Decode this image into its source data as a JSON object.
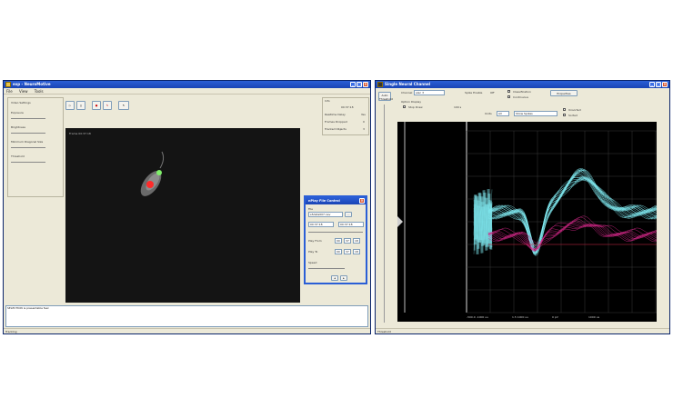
{
  "left_window": {
    "title": "exp - NeuroMotive",
    "menu": [
      "File",
      "View",
      "Tools"
    ],
    "video_settings_label": "Video Settings",
    "settings": [
      "Exposure",
      "Brightness",
      "Minimum Diagonal Size",
      "Threshold"
    ],
    "stats_header": "Info",
    "stats": [
      {
        "label": "",
        "value": "00:37:18"
      },
      {
        "label": "Realtime Delay",
        "value": "Yes"
      },
      {
        "label": "Frames Dropped",
        "value": "0"
      },
      {
        "label": "Tracked Objects",
        "value": "3"
      }
    ],
    "video_overlay_text": "Frame 00:37:18",
    "log_text": "SELECTION is presentable feel",
    "status_text": "Tracking"
  },
  "playback_dialog": {
    "title": "nPlay File Control",
    "file_label": "File",
    "file_value": "s5data007.nev",
    "time_start": "00:37:18",
    "time_end": "00:37:18",
    "play_from_label": "Play From",
    "play_to_label": "Play To",
    "speed_label": "Speed",
    "from_fields": [
      "00",
      "37",
      "18"
    ],
    "to_fields": [
      "00",
      "37",
      "18"
    ]
  },
  "right_window": {
    "title": "Single Neural Channel",
    "side_top_label": "Auto Threshold",
    "channel_label": "Channel",
    "channel_value": "elec 3",
    "spike_enable_label": "Spike Enable",
    "spike_enable_value": "Off",
    "classification_label": "Classification",
    "continuous_label": "Continuous",
    "properties_button": "Properties",
    "option_display_label": "Option Display",
    "stop_draw_label": "Stop Draw",
    "rate_value": "100 s",
    "units_label": "Units",
    "units_value": "All",
    "noise_label": "Show Spikes",
    "unsorted_label": "Unsorted",
    "sorted_label": "Sorted",
    "axis_labels": [
      "-500.0 -1000 us",
      "1.5 1000 us",
      "0 pV",
      "1000 us"
    ],
    "bottom_status": "Threshold"
  },
  "colors": {
    "titlebar": "#1a44b5",
    "window_bg": "#ece9d8",
    "scope_bg": "#000000",
    "trace_cyan": "#7fe8ee",
    "trace_magenta": "#d6288a",
    "grid": "#3a3a3a",
    "tracked_green": "#7ff06a",
    "tracked_red": "#ff2a2a"
  }
}
